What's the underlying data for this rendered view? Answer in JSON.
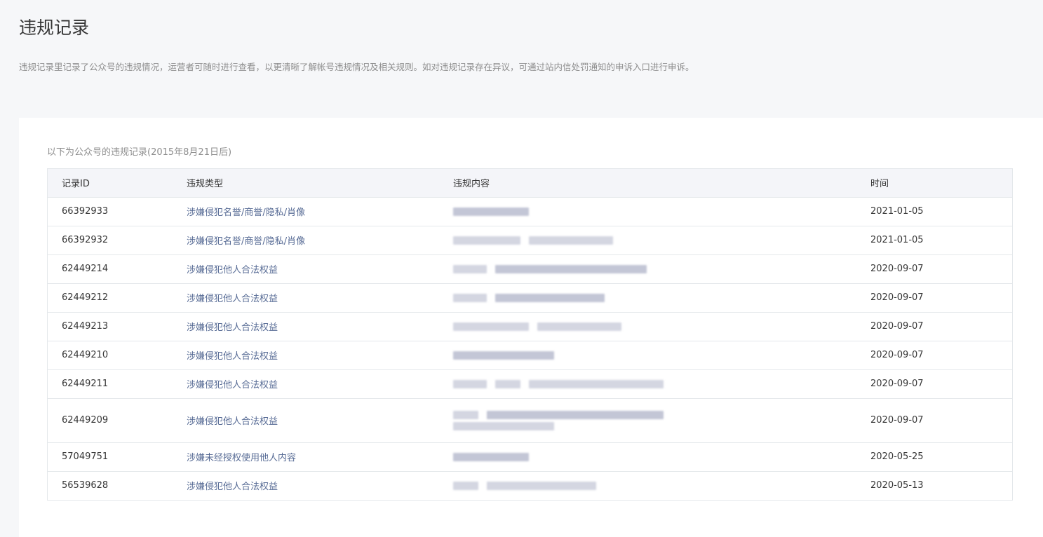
{
  "page": {
    "title": "违规记录",
    "description": "违规记录里记录了公众号的违规情况，运营者可随时进行查看，以更清晰了解帐号违规情况及相关规则。如对违规记录存在异议，可通过站内信处罚通知的申诉入口进行申诉。"
  },
  "table": {
    "caption": "以下为公众号的违规记录(2015年8月21日后)",
    "headers": {
      "id": "记录ID",
      "type": "违规类型",
      "content": "违规内容",
      "time": "时间"
    },
    "rows": [
      {
        "id": "66392933",
        "type": "涉嫌侵犯名誉/商誉/隐私/肖像",
        "time": "2021-01-05"
      },
      {
        "id": "66392932",
        "type": "涉嫌侵犯名誉/商誉/隐私/肖像",
        "time": "2021-01-05"
      },
      {
        "id": "62449214",
        "type": "涉嫌侵犯他人合法权益",
        "time": "2020-09-07"
      },
      {
        "id": "62449212",
        "type": "涉嫌侵犯他人合法权益",
        "time": "2020-09-07"
      },
      {
        "id": "62449213",
        "type": "涉嫌侵犯他人合法权益",
        "time": "2020-09-07"
      },
      {
        "id": "62449210",
        "type": "涉嫌侵犯他人合法权益",
        "time": "2020-09-07"
      },
      {
        "id": "62449211",
        "type": "涉嫌侵犯他人合法权益",
        "time": "2020-09-07"
      },
      {
        "id": "62449209",
        "type": "涉嫌侵犯他人合法权益",
        "time": "2020-09-07"
      },
      {
        "id": "57049751",
        "type": "涉嫌未经授权使用他人内容",
        "time": "2020-05-25"
      },
      {
        "id": "56539628",
        "type": "涉嫌侵犯他人合法权益",
        "time": "2020-05-13"
      }
    ]
  }
}
